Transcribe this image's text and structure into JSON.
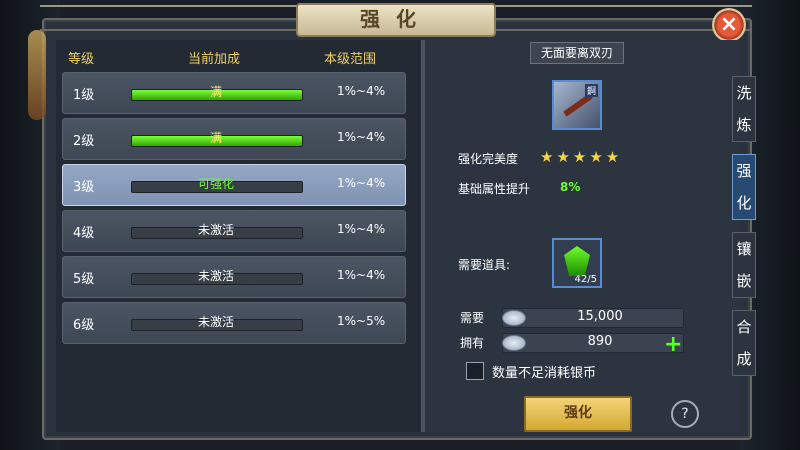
{
  "window": {
    "title": "强化",
    "close_icon": "close-icon"
  },
  "left_table": {
    "headers": [
      "等级",
      "当前加成",
      "本级范围"
    ],
    "rows": [
      {
        "level": "1级",
        "status": "满",
        "range": "1%~4%",
        "state": "full"
      },
      {
        "level": "2级",
        "status": "满",
        "range": "1%~4%",
        "state": "full"
      },
      {
        "level": "3级",
        "status": "可强化",
        "range": "1%~4%",
        "state": "available"
      },
      {
        "level": "4级",
        "status": "未激活",
        "range": "1%~4%",
        "state": "inactive"
      },
      {
        "level": "5级",
        "status": "未激活",
        "range": "1%~4%",
        "state": "inactive"
      },
      {
        "level": "6级",
        "status": "未激活",
        "range": "1%~5%",
        "state": "inactive"
      }
    ]
  },
  "right_panel": {
    "item_name": "无面要离双刃",
    "item_tag": "錒",
    "perfection_label": "强化完美度",
    "perfection_stars": 5,
    "base_attr_label": "基础属性提升",
    "base_attr_value": "8%",
    "material_label": "需要道具:",
    "material_count": "42/5",
    "need_label": "需要",
    "need_value": "15,000",
    "have_label": "拥有",
    "have_value": "890",
    "checkbox_label": "数量不足消耗银币",
    "enhance_button": "强化",
    "help_label": "?"
  },
  "side_tabs": [
    {
      "label": "洗\n炼",
      "active": false
    },
    {
      "label": "强\n化",
      "active": true
    },
    {
      "label": "镶\n嵌",
      "active": false
    },
    {
      "label": "合\n成",
      "active": false
    }
  ],
  "colors": {
    "accent_green": "#6dff2b",
    "accent_gold": "#f0cf63",
    "selected_row": "#8fa4c2"
  }
}
